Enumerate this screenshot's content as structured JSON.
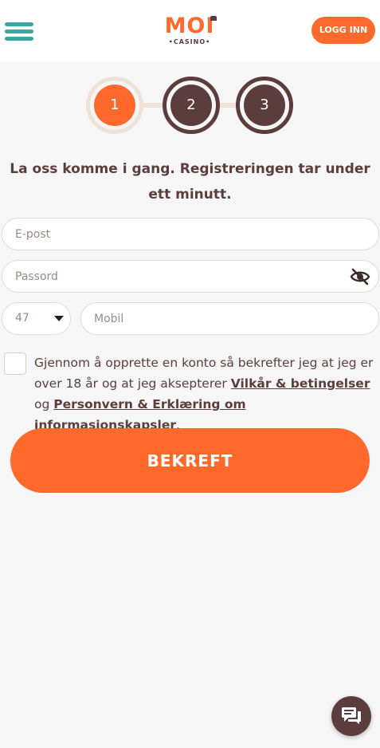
{
  "header": {
    "logo_main": "MOI",
    "logo_sub": "•CASINO•",
    "login_label": "LOGG INN"
  },
  "steps": [
    {
      "number": "1",
      "state": "active"
    },
    {
      "number": "2",
      "state": "pending"
    },
    {
      "number": "3",
      "state": "pending"
    }
  ],
  "heading": "La oss komme i gang. Registreringen tar under ett minutt.",
  "form": {
    "email_placeholder": "E-post",
    "password_placeholder": "Passord",
    "country_code": "47",
    "mobile_placeholder": "Mobil"
  },
  "terms": {
    "text_1": "Gjennom å opprette en konto så bekrefter jeg at jeg er over 18 år og at jeg aksepterer ",
    "link_1": "Vilkår & betingelser",
    "text_2": " og ",
    "link_2": "Personvern & Erklæring om informasjonskapsler",
    "text_3": "."
  },
  "submit_label": "BEKREFT",
  "colors": {
    "accent": "#ff6a2c",
    "brown": "#5c3d3d",
    "teal": "#3aa6a0",
    "background": "#f6f6f6"
  },
  "icons": [
    "hamburger-menu-icon",
    "eye-slash-icon",
    "caret-down-icon",
    "chat-icon"
  ]
}
